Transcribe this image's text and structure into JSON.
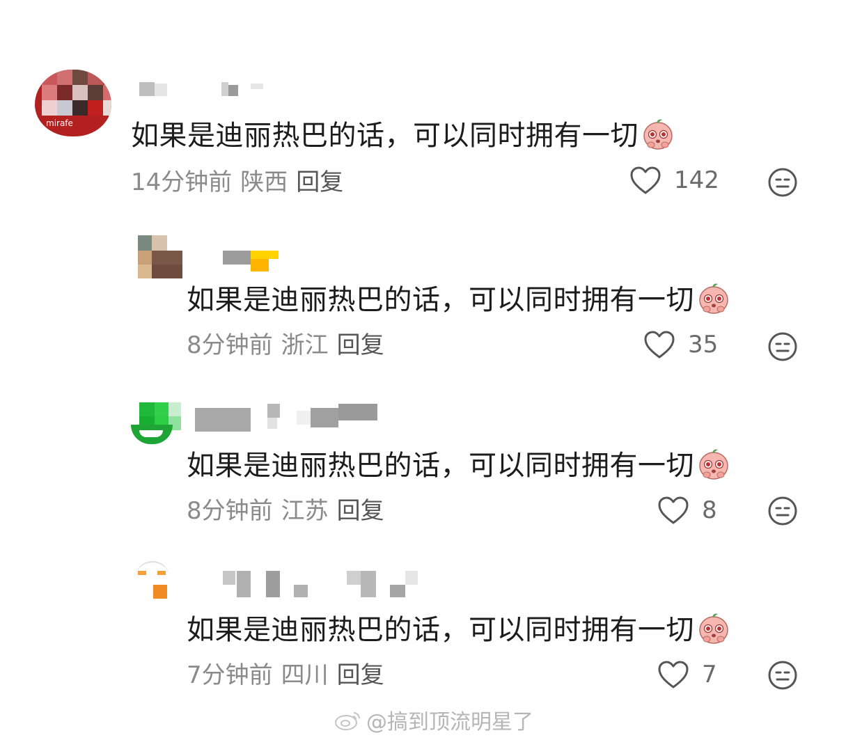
{
  "comments": [
    {
      "text": "如果是迪丽热巴的话，可以同时拥有一切",
      "time": "14分钟前",
      "region": "陕西",
      "reply_label": "回复",
      "likes": "142",
      "avatar_text": "mirafe"
    },
    {
      "text": "如果是迪丽热巴的话，可以同时拥有一切",
      "time": "8分钟前",
      "region": "浙江",
      "reply_label": "回复",
      "likes": "35"
    },
    {
      "text": "如果是迪丽热巴的话，可以同时拥有一切",
      "time": "8分钟前",
      "region": "江苏",
      "reply_label": "回复",
      "likes": "8"
    },
    {
      "text": "如果是迪丽热巴的话，可以同时拥有一切",
      "time": "7分钟前",
      "region": "四川",
      "reply_label": "回复",
      "likes": "7"
    }
  ],
  "icons": {
    "like": "heart-outline-icon",
    "dislike": "neutral-face-icon",
    "emoji": "pleading-peach-emoji"
  },
  "colors": {
    "text": "#1c1c1c",
    "meta": "#8a8a8a",
    "icon": "#555555",
    "emoji_pink": "#f4a7a0"
  },
  "watermark": "@搞到顶流明星了"
}
